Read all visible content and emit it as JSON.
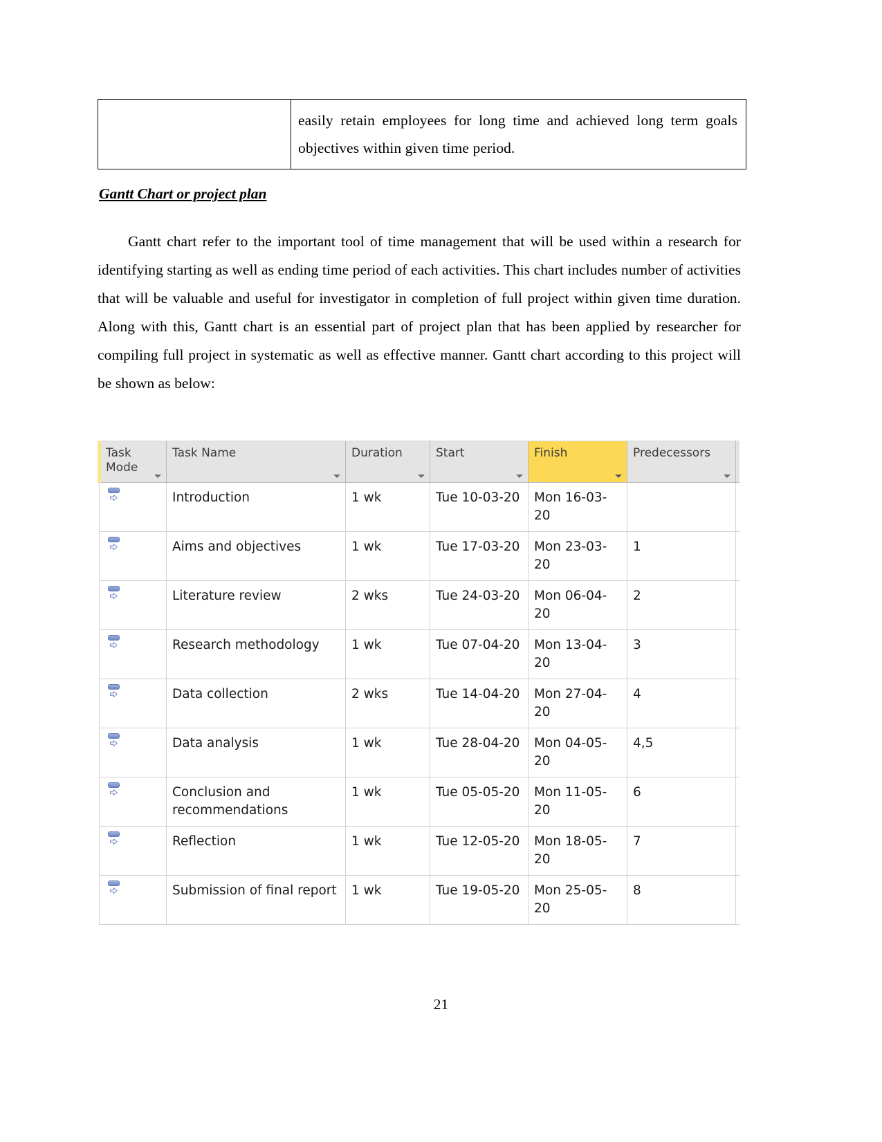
{
  "document": {
    "page_number": "21",
    "continued_table": {
      "left_cell": "",
      "right_cell": "easily retain employees for long time  and achieved long term goals objectives within given time period."
    },
    "heading": "Gantt Chart or project plan",
    "paragraph": "Gantt chart refer to the important tool of time management that will be used within a research for identifying starting as well as ending time period of each activities. This chart includes number of activities that will be valuable and useful for investigator in completion of full project within given time duration. Along with this, Gantt chart is an essential part of project plan that has been applied by researcher for compiling full project in systematic as well as effective manner. Gantt chart according to this project will be shown as below:"
  },
  "gantt": {
    "columns": [
      {
        "key": "task_mode",
        "label": "Task Mode",
        "highlighted": false
      },
      {
        "key": "task_name",
        "label": "Task Name",
        "highlighted": false
      },
      {
        "key": "duration",
        "label": "Duration",
        "highlighted": false
      },
      {
        "key": "start",
        "label": "Start",
        "highlighted": false
      },
      {
        "key": "finish",
        "label": "Finish",
        "highlighted": true
      },
      {
        "key": "predecessors",
        "label": "Predecessors",
        "highlighted": false
      }
    ],
    "highlight_color": "#fdd855",
    "header_color": "#e4e4e4",
    "rows": [
      {
        "mode": "auto-scheduled",
        "name": "Introduction",
        "duration": "1 wk",
        "start": "Tue 10-03-20",
        "finish": "Mon 16-03-20",
        "predecessors": ""
      },
      {
        "mode": "auto-scheduled",
        "name": "Aims and objectives",
        "duration": "1 wk",
        "start": "Tue 17-03-20",
        "finish": "Mon 23-03-20",
        "predecessors": "1"
      },
      {
        "mode": "auto-scheduled",
        "name": "Literature review",
        "duration": "2 wks",
        "start": "Tue 24-03-20",
        "finish": "Mon 06-04-20",
        "predecessors": "2"
      },
      {
        "mode": "auto-scheduled",
        "name": "Research methodology",
        "duration": "1 wk",
        "start": "Tue 07-04-20",
        "finish": "Mon 13-04-20",
        "predecessors": "3"
      },
      {
        "mode": "auto-scheduled",
        "name": "Data collection",
        "duration": "2 wks",
        "start": "Tue 14-04-20",
        "finish": "Mon 27-04-20",
        "predecessors": "4"
      },
      {
        "mode": "auto-scheduled",
        "name": "Data analysis",
        "duration": "1 wk",
        "start": "Tue 28-04-20",
        "finish": "Mon 04-05-20",
        "predecessors": "4,5"
      },
      {
        "mode": "auto-scheduled",
        "name": "Conclusion and recommendations",
        "duration": "1 wk",
        "start": "Tue 05-05-20",
        "finish": "Mon 11-05-20",
        "predecessors": "6"
      },
      {
        "mode": "auto-scheduled",
        "name": "Reflection",
        "duration": "1 wk",
        "start": "Tue 12-05-20",
        "finish": "Mon 18-05-20",
        "predecessors": "7"
      },
      {
        "mode": "auto-scheduled",
        "name": "Submission of final report",
        "duration": "1 wk",
        "start": "Tue 19-05-20",
        "finish": "Mon 25-05-20",
        "predecessors": "8"
      }
    ]
  }
}
